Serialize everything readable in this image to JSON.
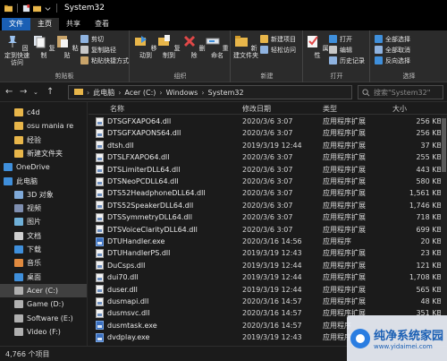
{
  "window": {
    "title": "System32"
  },
  "ribbon_tabs": [
    "文件",
    "主页",
    "共享",
    "查看"
  ],
  "ribbon": {
    "groups": {
      "clipboard": {
        "label": "剪贴板",
        "pin": "固定到快速访问",
        "copy": "复制",
        "paste": "粘贴",
        "cut": "剪切",
        "copy_path": "复制路径",
        "paste_shortcut": "粘贴快捷方式"
      },
      "organize": {
        "label": "组织",
        "move_to": "移动到",
        "copy_to": "复制到",
        "delete": "删除",
        "rename": "重命名"
      },
      "new": {
        "label": "新建",
        "new_folder": "新建文件夹",
        "new_item": "新建项目",
        "easy_access": "轻松访问"
      },
      "open": {
        "label": "打开",
        "properties": "属性",
        "open": "打开",
        "edit": "编辑",
        "history": "历史记录"
      },
      "select": {
        "label": "选择",
        "select_all": "全部选择",
        "select_none": "全部取消",
        "invert": "反向选择"
      }
    }
  },
  "address": {
    "crumbs": [
      "此电脑",
      "Acer (C:)",
      "Windows",
      "System32"
    ],
    "search_placeholder": "搜索\"System32\""
  },
  "nav": [
    {
      "label": "c4d",
      "icon": "folder-icon"
    },
    {
      "label": "osu mania re",
      "icon": "folder-icon"
    },
    {
      "label": "经验",
      "icon": "folder-icon"
    },
    {
      "label": "新建文件夹",
      "icon": "folder-icon"
    },
    {
      "label": "OneDrive",
      "icon": "cloud-icon"
    },
    {
      "label": "此电脑",
      "icon": "computer-icon"
    },
    {
      "label": "3D 对象",
      "icon": "cube-icon"
    },
    {
      "label": "视频",
      "icon": "video-icon"
    },
    {
      "label": "图片",
      "icon": "picture-icon"
    },
    {
      "label": "文档",
      "icon": "document-icon"
    },
    {
      "label": "下载",
      "icon": "download-icon"
    },
    {
      "label": "音乐",
      "icon": "music-icon"
    },
    {
      "label": "桌面",
      "icon": "desktop-icon"
    },
    {
      "label": "Acer (C:)",
      "icon": "drive-icon",
      "selected": true
    },
    {
      "label": "Game (D:)",
      "icon": "drive-icon"
    },
    {
      "label": "Software (E:)",
      "icon": "drive-icon"
    },
    {
      "label": "Video (F:)",
      "icon": "drive-icon"
    }
  ],
  "columns": {
    "name": "名称",
    "date": "修改日期",
    "type": "类型",
    "size": "大小"
  },
  "files": [
    {
      "name": "DTSGFXAPO64.dll",
      "date": "2020/3/6 3:07",
      "type": "应用程序扩展",
      "size": "256 KB",
      "kind": "dll"
    },
    {
      "name": "DTSGFXAPONS64.dll",
      "date": "2020/3/6 3:07",
      "type": "应用程序扩展",
      "size": "256 KB",
      "kind": "dll"
    },
    {
      "name": "dtsh.dll",
      "date": "2019/3/19 12:44",
      "type": "应用程序扩展",
      "size": "37 KB",
      "kind": "dll"
    },
    {
      "name": "DTSLFXAPO64.dll",
      "date": "2020/3/6 3:07",
      "type": "应用程序扩展",
      "size": "255 KB",
      "kind": "dll"
    },
    {
      "name": "DTSLimiterDLL64.dll",
      "date": "2020/3/6 3:07",
      "type": "应用程序扩展",
      "size": "443 KB",
      "kind": "dll"
    },
    {
      "name": "DTSNeoPCDLL64.dll",
      "date": "2020/3/6 3:07",
      "type": "应用程序扩展",
      "size": "580 KB",
      "kind": "dll"
    },
    {
      "name": "DTS52HeadphoneDLL64.dll",
      "date": "2020/3/6 3:07",
      "type": "应用程序扩展",
      "size": "1,561 KB",
      "kind": "dll"
    },
    {
      "name": "DTS52SpeakerDLL64.dll",
      "date": "2020/3/6 3:07",
      "type": "应用程序扩展",
      "size": "1,746 KB",
      "kind": "dll"
    },
    {
      "name": "DTSSymmetryDLL64.dll",
      "date": "2020/3/6 3:07",
      "type": "应用程序扩展",
      "size": "718 KB",
      "kind": "dll"
    },
    {
      "name": "DTSVoiceClarityDLL64.dll",
      "date": "2020/3/6 3:07",
      "type": "应用程序扩展",
      "size": "699 KB",
      "kind": "dll"
    },
    {
      "name": "DTUHandler.exe",
      "date": "2020/3/16 14:56",
      "type": "应用程序",
      "size": "20 KB",
      "kind": "exe"
    },
    {
      "name": "DTUHandlerPS.dll",
      "date": "2019/3/19 12:43",
      "type": "应用程序扩展",
      "size": "23 KB",
      "kind": "dll"
    },
    {
      "name": "DuCsps.dll",
      "date": "2019/3/19 12:44",
      "type": "应用程序扩展",
      "size": "121 KB",
      "kind": "dll"
    },
    {
      "name": "dui70.dll",
      "date": "2019/3/19 12:44",
      "type": "应用程序扩展",
      "size": "1,708 KB",
      "kind": "dll"
    },
    {
      "name": "duser.dll",
      "date": "2019/3/19 12:44",
      "type": "应用程序扩展",
      "size": "565 KB",
      "kind": "dll"
    },
    {
      "name": "dusmapi.dll",
      "date": "2020/3/16 14:57",
      "type": "应用程序扩展",
      "size": "48 KB",
      "kind": "dll"
    },
    {
      "name": "dusmsvc.dll",
      "date": "2020/3/16 14:57",
      "type": "应用程序扩展",
      "size": "351 KB",
      "kind": "dll"
    },
    {
      "name": "dusmtask.exe",
      "date": "2020/3/16 14:57",
      "type": "应用程序",
      "size": "",
      "kind": "exe"
    },
    {
      "name": "dvdplay.exe",
      "date": "2019/3/19 12:43",
      "type": "应用程序",
      "size": "",
      "kind": "exe"
    }
  ],
  "status": {
    "count": "4,766 个项目"
  },
  "watermark": {
    "title": "纯净系统家园",
    "url": "www.yidaimei.com"
  },
  "colors": {
    "file_tab": "#1a5fb4",
    "selected": "#404040",
    "background": "#1b1b1b"
  }
}
